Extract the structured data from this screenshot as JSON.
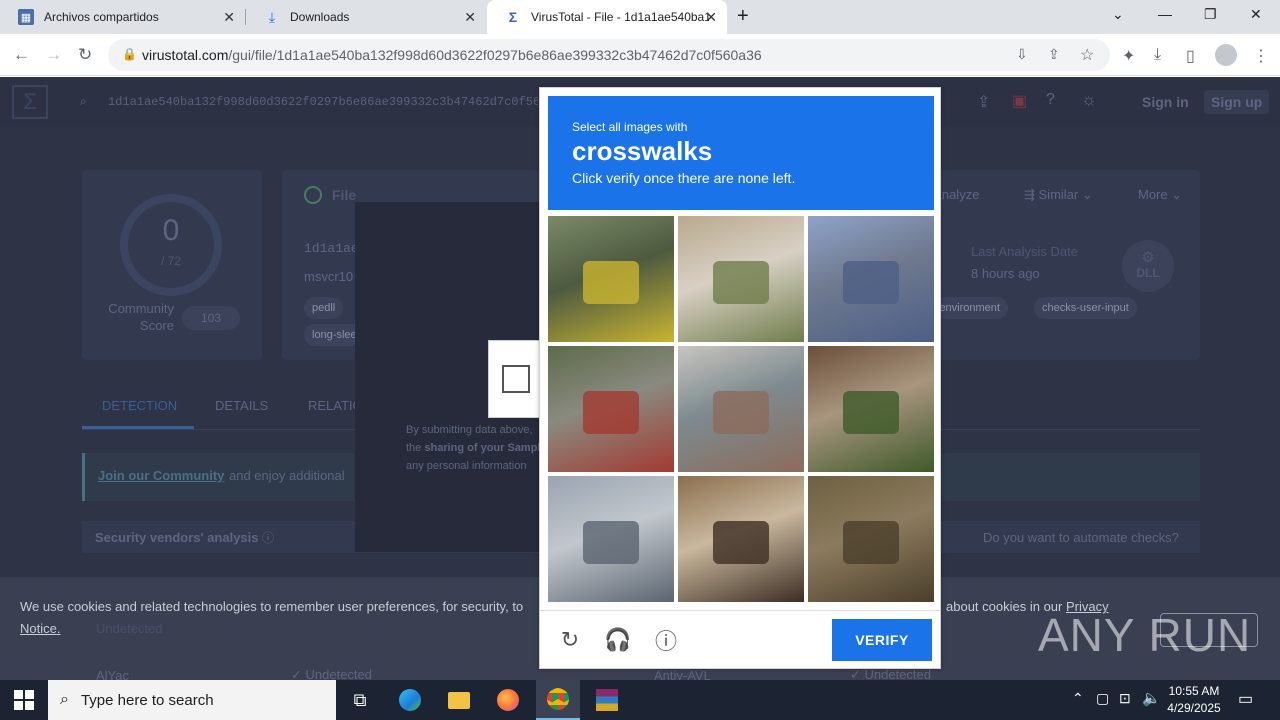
{
  "browser": {
    "tabs": [
      {
        "title": "Archivos compartidos",
        "active": false
      },
      {
        "title": "Downloads",
        "active": false
      },
      {
        "title": "VirusTotal - File - 1d1a1ae540ba1",
        "active": true
      }
    ],
    "new_tab": "+",
    "url_host": "virustotal.com",
    "url_path": "/gui/file/1d1a1ae540ba132f998d60d3622f0297b6e86ae399332c3b47462d7c0f560a36"
  },
  "vt": {
    "search_value": "1d1a1ae540ba132f998d60d3622f0297b6e86ae399332c3b47462d7c0f560a",
    "sign_in": "Sign in",
    "sign_up": "Sign up",
    "score": "0",
    "score_total": "/ 72",
    "community_label": "Community Score",
    "community_value": "103",
    "file_title_partial": "File",
    "hash_partial": "1d1a1ae",
    "name_partial": "msvcr10",
    "reanalyze": "Reanalyze",
    "similar": "Similar",
    "more": "More",
    "last_analysis_label": "Last Analysis Date",
    "last_analysis_value": "8 hours ago",
    "file_type": "DLL",
    "tags_left": [
      "pedll",
      "long-slee"
    ],
    "tags_right": [
      "-g-environment",
      "checks-user-input"
    ],
    "tabs": [
      "DETECTION",
      "DETAILS",
      "RELATIO"
    ],
    "community_banner_link": "Join our Community",
    "community_banner_text": " and enjoy additional",
    "vendors_heading": "Security vendors' analysis",
    "automate": "Do you want to automate checks?",
    "submit_text_1": "By submitting data above,",
    "submit_text_2a": "the ",
    "submit_text_2b": "sharing of your Sampl",
    "submit_text_3": "any personal information",
    "vendor_rows": [
      {
        "name": "AlYac",
        "result": "Undetected",
        "name2": "Antiy-AVL",
        "result2": "Undetected"
      }
    ],
    "cookie_text_1": "We use cookies and related technologies to remember user preferences, for security, to",
    "cookie_text_2": "about cookies in our ",
    "cookie_link": "Privacy",
    "cookie_link_2": "Notice",
    "cookie_behind": "Undetected"
  },
  "captcha": {
    "line1": "Select all images with",
    "keyword": "crosswalks",
    "line3": "Click verify once there are none left.",
    "verify": "VERIFY",
    "tiles": [
      {
        "desc": "yellow trolleybus on city street",
        "colors": [
          "#7b8a6a",
          "#c9b431",
          "#4d5a3f"
        ]
      },
      {
        "desc": "sidewalk with stairs and palm tree",
        "colors": [
          "#b9a98e",
          "#6f7d4b",
          "#d8d0c4"
        ]
      },
      {
        "desc": "motorcyclist on road",
        "colors": [
          "#8fa3c8",
          "#4d5f86",
          "#6f7a8f"
        ]
      },
      {
        "desc": "red double-decker bus on road",
        "colors": [
          "#5d6b4a",
          "#a33a31",
          "#8a8a80"
        ]
      },
      {
        "desc": "road under bridge",
        "colors": [
          "#c8c5c0",
          "#8c6c5b",
          "#7d8a8f"
        ]
      },
      {
        "desc": "brick porch with plants",
        "colors": [
          "#6b4f3a",
          "#3e5a2a",
          "#a8957e"
        ]
      },
      {
        "desc": "traffic lights at intersection",
        "colors": [
          "#9aa4b1",
          "#5b6470",
          "#c1c7cc"
        ]
      },
      {
        "desc": "house with gate",
        "colors": [
          "#8b6f4e",
          "#3d2e24",
          "#c9b89e"
        ]
      },
      {
        "desc": "stone steps with fence",
        "colors": [
          "#6d6040",
          "#4b3f2b",
          "#8c7b5e"
        ]
      }
    ]
  },
  "watermark": "ANY RUN",
  "taskbar": {
    "search_placeholder": "Type here to search",
    "time": "10:55 AM",
    "date": "4/29/2025"
  }
}
